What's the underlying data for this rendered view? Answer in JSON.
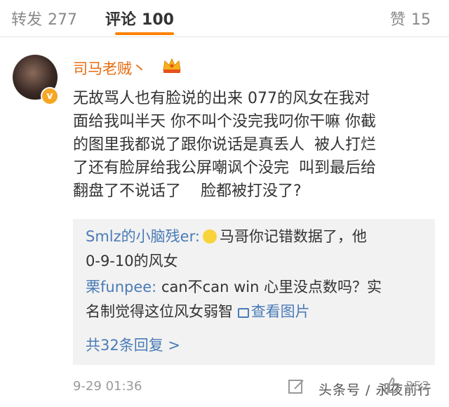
{
  "tabs": {
    "repost": {
      "label": "转发",
      "count": "277"
    },
    "comment": {
      "label": "评论",
      "count": "100"
    },
    "like": {
      "label": "赞",
      "count": "15"
    }
  },
  "comment": {
    "username": "司马老贼丶",
    "verify_badge": "v",
    "lines": [
      "无故骂人也有脸说的出来 077的风女在我对",
      "面给我叫半天 你不叫个没完我叼你干嘛 你截",
      "的图里我都说了跟你说话是真丢人  被人打烂",
      "了还有脸屏给我公屏嘲讽个没完  叫到最后给",
      "翻盘了不说话了    脸都被打没了?"
    ],
    "timestamp": "9-29 01:36",
    "like_count": "352"
  },
  "replies": [
    {
      "name": "Smlz的小脑残er:",
      "emoji": "smile-emoji",
      "line1": "马哥你记错数据了，他",
      "line2": "0-9-10的风女"
    },
    {
      "name": "栗funpee:",
      "line1": " can不can win 心里没点数吗？实",
      "line2": "名制觉得这位风女弱智 ",
      "view_image": "查看图片"
    }
  ],
  "more_replies": "共32条回复 >",
  "watermark": "头条号 / 永夜前行",
  "colors": {
    "accent": "#ff8200",
    "username": "#e86c10",
    "link": "#4a7bb7",
    "reply_bg": "#f2f2f2"
  }
}
